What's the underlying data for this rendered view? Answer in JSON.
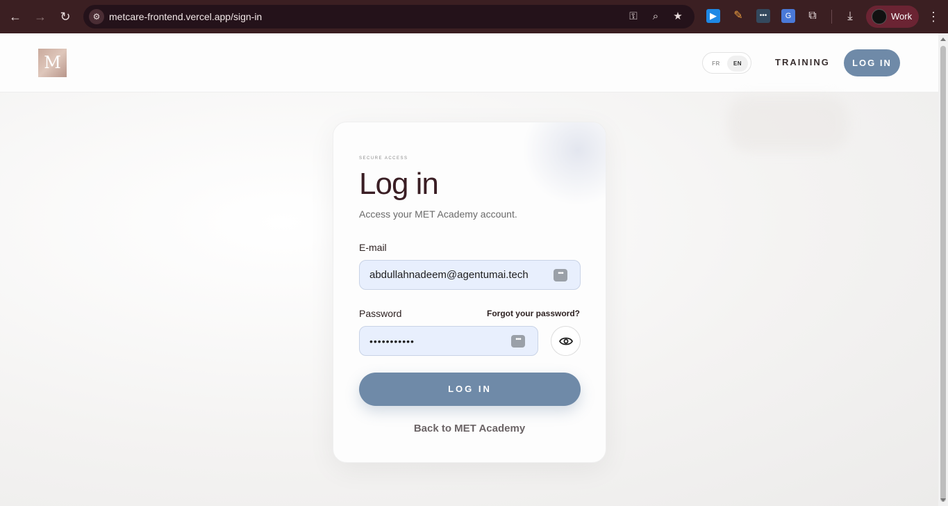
{
  "browser": {
    "url": "metcare-frontend.vercel.app/sign-in",
    "profile_label": "Work",
    "icons": [
      "back-icon",
      "forward-icon",
      "reload-icon",
      "site-info-icon",
      "password-key-icon",
      "zoom-icon",
      "bookmark-star-icon",
      "extensions-icon",
      "download-icon",
      "menu-icon"
    ]
  },
  "header": {
    "logo_letter": "M",
    "lang_fr": "FR",
    "lang_en": "EN",
    "nav_training": "TRAINING",
    "nav_login": "LOG IN"
  },
  "card": {
    "eyebrow": "SECURE ACCESS",
    "title": "Log in",
    "subtitle": "Access your MET Academy account.",
    "email_label": "E-mail",
    "email_value": "abdullahnadeem@agentumai.tech",
    "password_label": "Password",
    "forgot_label": "Forgot your password?",
    "password_value": "•••••••••••",
    "submit_label": "LOG IN",
    "back_label": "Back to MET Academy"
  },
  "colors": {
    "accent": "#6f8aa8",
    "title": "#3a1e24",
    "field_bg": "#e8effd",
    "chrome_bg": "#3b1f22"
  }
}
